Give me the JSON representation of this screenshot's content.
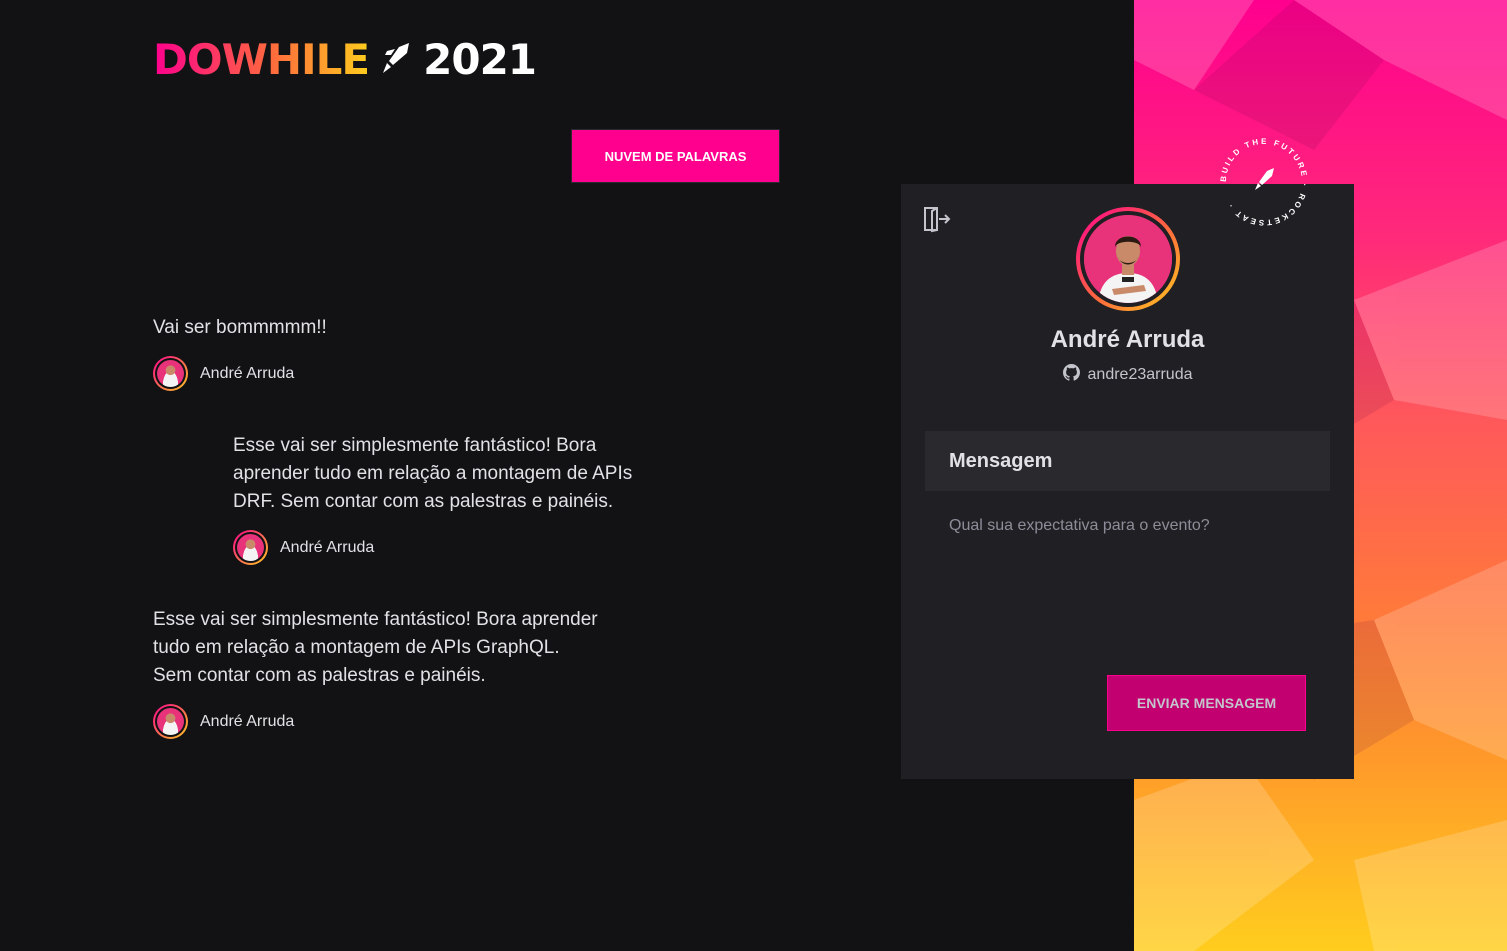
{
  "logo": {
    "word": "DOWHILE",
    "year": "2021"
  },
  "cloud_button_label": "NUVEM DE PALAVRAS",
  "messages": [
    {
      "text": "Vai ser bommmmm!!",
      "author": "André Arruda"
    },
    {
      "text": "Esse vai ser simplesmente fantástico! Bora aprender tudo em relação a montagem de APIs DRF. Sem contar com as palestras e painéis.",
      "author": "André Arruda"
    },
    {
      "text": "Esse vai ser simplesmente fantástico! Bora aprender tudo em relação a montagem de APIs GraphQL. Sem contar com as palestras e painéis.",
      "author": "André Arruda"
    }
  ],
  "profile": {
    "name": "André Arruda",
    "github_login": "andre23arruda"
  },
  "form": {
    "title": "Mensagem",
    "placeholder": "Qual sua expectativa para o evento?",
    "submit_label": "ENVIAR MENSAGEM"
  },
  "badge": {
    "text": "BUILD THE FUTURE · ROCKETSEAT ·"
  },
  "colors": {
    "background": "#121214",
    "accent_pink": "#ff008e",
    "accent_yellow": "#ffcd1e",
    "card": "#1f1f24"
  },
  "icons": [
    "rocket-icon",
    "sign-out-icon",
    "github-icon"
  ]
}
